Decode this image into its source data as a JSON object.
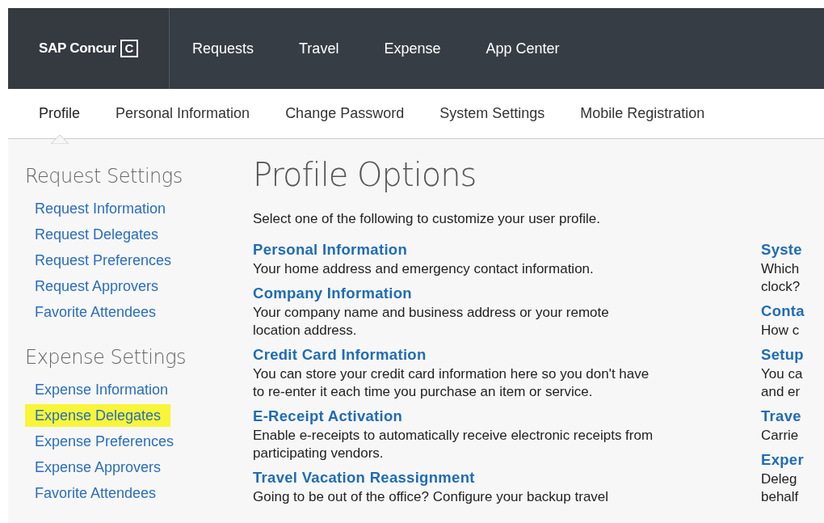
{
  "top_nav": {
    "logo": {
      "text": "SAP Concur",
      "mark": "C"
    },
    "items": [
      {
        "label": "Requests"
      },
      {
        "label": "Travel"
      },
      {
        "label": "Expense"
      },
      {
        "label": "App Center"
      }
    ]
  },
  "sub_nav": [
    {
      "label": "Profile",
      "selected": true
    },
    {
      "label": "Personal Information",
      "selected": false
    },
    {
      "label": "Change Password",
      "selected": false
    },
    {
      "label": "System Settings",
      "selected": false
    },
    {
      "label": "Mobile Registration",
      "selected": false
    }
  ],
  "sidebar": [
    {
      "heading": "Request Settings",
      "links": [
        {
          "label": "Request Information",
          "highlighted": false
        },
        {
          "label": "Request Delegates",
          "highlighted": false
        },
        {
          "label": "Request Preferences",
          "highlighted": false
        },
        {
          "label": "Request Approvers",
          "highlighted": false
        },
        {
          "label": "Favorite Attendees",
          "highlighted": false
        }
      ]
    },
    {
      "heading": "Expense Settings",
      "links": [
        {
          "label": "Expense Information",
          "highlighted": false
        },
        {
          "label": "Expense Delegates",
          "highlighted": true
        },
        {
          "label": "Expense Preferences",
          "highlighted": false
        },
        {
          "label": "Expense Approvers",
          "highlighted": false
        },
        {
          "label": "Favorite Attendees",
          "highlighted": false
        }
      ]
    }
  ],
  "main": {
    "title": "Profile Options",
    "intro": "Select one of the following to customize your user profile.",
    "columns": [
      [
        {
          "title": "Personal Information",
          "lines": [
            "Your home address and emergency contact information."
          ]
        },
        {
          "title": "Company Information",
          "lines": [
            "Your company name and business address or your remote",
            "location address."
          ]
        },
        {
          "title": "Credit Card Information",
          "lines": [
            "You can store your credit card information here so you don't have",
            "to re-enter it each time you purchase an item or service."
          ]
        },
        {
          "title": "E-Receipt Activation",
          "lines": [
            "Enable e-receipts to automatically receive electronic receipts from",
            "participating vendors."
          ]
        },
        {
          "title": "Travel Vacation Reassignment",
          "lines": [
            "Going to be out of the office? Configure your backup travel"
          ]
        }
      ],
      [
        {
          "title": "Syste",
          "lines": [
            "Which",
            "clock?"
          ]
        },
        {
          "title": "Conta",
          "lines": [
            "How c"
          ]
        },
        {
          "title": "Setup",
          "lines": [
            "You ca",
            "and er"
          ]
        },
        {
          "title": "Trave",
          "lines": [
            "Carrie"
          ]
        },
        {
          "title": "Exper",
          "lines": [
            "Deleg",
            "behalf"
          ]
        }
      ]
    ]
  }
}
